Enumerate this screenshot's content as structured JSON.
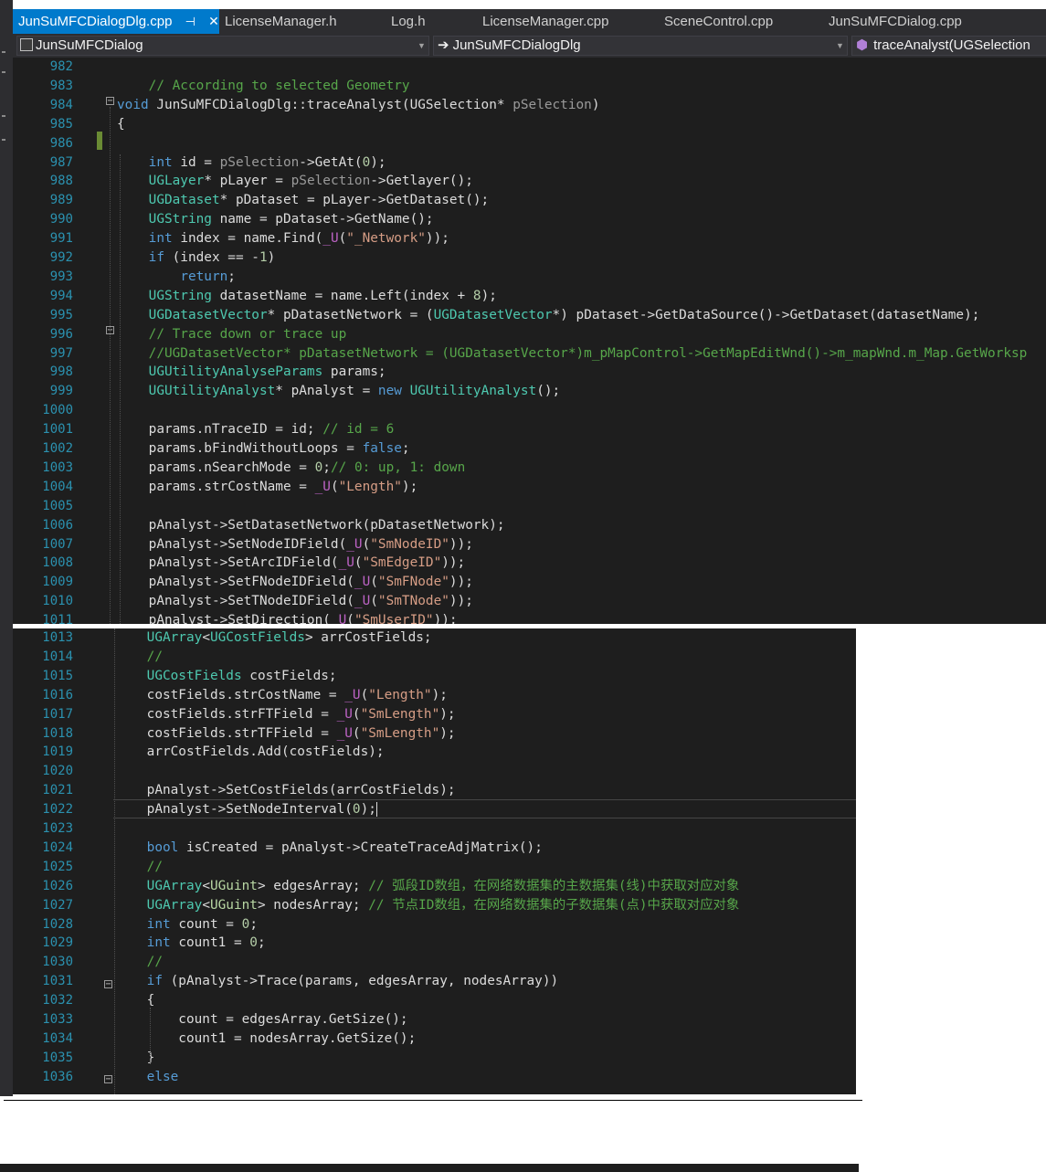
{
  "tabs": [
    {
      "label": "JunSuMFCDialogDlg.cpp",
      "active": true
    },
    {
      "label": "LicenseManager.h",
      "active": false
    },
    {
      "label": "Log.h",
      "active": false
    },
    {
      "label": "LicenseManager.cpp",
      "active": false
    },
    {
      "label": "SceneControl.cpp",
      "active": false
    },
    {
      "label": "JunSuMFCDialog.cpp",
      "active": false
    }
  ],
  "nav": {
    "project": "JunSuMFCDialog",
    "class": "JunSuMFCDialogDlg",
    "member": "traceAnalyst(UGSelection"
  },
  "pane1_lines": [
    {
      "n": "982",
      "code": ""
    },
    {
      "n": "983",
      "code": "    // According to selected Geometry"
    },
    {
      "n": "984",
      "code": "void JunSuMFCDialogDlg::traceAnalyst(UGSelection* pSelection)"
    },
    {
      "n": "985",
      "code": "{"
    },
    {
      "n": "986",
      "code": ""
    },
    {
      "n": "987",
      "code": "    int id = pSelection->GetAt(0);"
    },
    {
      "n": "988",
      "code": "    UGLayer* pLayer = pSelection->Getlayer();"
    },
    {
      "n": "989",
      "code": "    UGDataset* pDataset = pLayer->GetDataset();"
    },
    {
      "n": "990",
      "code": "    UGString name = pDataset->GetName();"
    },
    {
      "n": "991",
      "code": "    int index = name.Find(_U(\"_Network\"));"
    },
    {
      "n": "992",
      "code": "    if (index == -1)"
    },
    {
      "n": "993",
      "code": "        return;"
    },
    {
      "n": "994",
      "code": "    UGString datasetName = name.Left(index + 8);"
    },
    {
      "n": "995",
      "code": "    UGDatasetVector* pDatasetNetwork = (UGDatasetVector*) pDataset->GetDataSource()->GetDataset(datasetName);"
    },
    {
      "n": "996",
      "code": "    // Trace down or trace up"
    },
    {
      "n": "997",
      "code": "    //UGDatasetVector* pDatasetNetwork = (UGDatasetVector*)m_pMapControl->GetMapEditWnd()->m_mapWnd.m_Map.GetWorksp"
    },
    {
      "n": "998",
      "code": "    UGUtilityAnalyseParams params;"
    },
    {
      "n": "999",
      "code": "    UGUtilityAnalyst* pAnalyst = new UGUtilityAnalyst();"
    },
    {
      "n": "1000",
      "code": ""
    },
    {
      "n": "1001",
      "code": "    params.nTraceID = id; // id = 6"
    },
    {
      "n": "1002",
      "code": "    params.bFindWithoutLoops = false;"
    },
    {
      "n": "1003",
      "code": "    params.nSearchMode = 0;// 0: up, 1: down"
    },
    {
      "n": "1004",
      "code": "    params.strCostName = _U(\"Length\");"
    },
    {
      "n": "1005",
      "code": ""
    },
    {
      "n": "1006",
      "code": "    pAnalyst->SetDatasetNetwork(pDatasetNetwork);"
    },
    {
      "n": "1007",
      "code": "    pAnalyst->SetNodeIDField(_U(\"SmNodeID\"));"
    },
    {
      "n": "1008",
      "code": "    pAnalyst->SetArcIDField(_U(\"SmEdgeID\"));"
    },
    {
      "n": "1009",
      "code": "    pAnalyst->SetFNodeIDField(_U(\"SmFNode\"));"
    },
    {
      "n": "1010",
      "code": "    pAnalyst->SetTNodeIDField(_U(\"SmTNode\"));"
    },
    {
      "n": "1011",
      "code": "    pAnalyst->SetDirection(_U(\"SmUserID\"));"
    }
  ],
  "pane2_lines": [
    {
      "n": "1013",
      "code": "    UGArray<UGCostFields> arrCostFields;"
    },
    {
      "n": "1014",
      "code": "    //"
    },
    {
      "n": "1015",
      "code": "    UGCostFields costFields;"
    },
    {
      "n": "1016",
      "code": "    costFields.strCostName = _U(\"Length\");"
    },
    {
      "n": "1017",
      "code": "    costFields.strFTField = _U(\"SmLength\");"
    },
    {
      "n": "1018",
      "code": "    costFields.strTFField = _U(\"SmLength\");"
    },
    {
      "n": "1019",
      "code": "    arrCostFields.Add(costFields);"
    },
    {
      "n": "1020",
      "code": ""
    },
    {
      "n": "1021",
      "code": "    pAnalyst->SetCostFields(arrCostFields);"
    },
    {
      "n": "1022",
      "code": "    pAnalyst->SetNodeInterval(0);"
    },
    {
      "n": "1023",
      "code": ""
    },
    {
      "n": "1024",
      "code": "    bool isCreated = pAnalyst->CreateTraceAdjMatrix();"
    },
    {
      "n": "1025",
      "code": "    //"
    },
    {
      "n": "1026",
      "code": "    UGArray<UGuint> edgesArray; // 弧段ID数组，在网络数据集的主数据集(线)中获取对应对象"
    },
    {
      "n": "1027",
      "code": "    UGArray<UGuint> nodesArray; // 节点ID数组，在网络数据集的子数据集(点)中获取对应对象"
    },
    {
      "n": "1028",
      "code": "    int count = 0;"
    },
    {
      "n": "1029",
      "code": "    int count1 = 0;"
    },
    {
      "n": "1030",
      "code": "    //"
    },
    {
      "n": "1031",
      "code": "    if (pAnalyst->Trace(params, edgesArray, nodesArray))"
    },
    {
      "n": "1032",
      "code": "    {"
    },
    {
      "n": "1033",
      "code": "        count = edgesArray.GetSize();"
    },
    {
      "n": "1034",
      "code": "        count1 = nodesArray.GetSize();"
    },
    {
      "n": "1035",
      "code": "    }"
    },
    {
      "n": "1036",
      "code": "    else"
    }
  ],
  "colors": {
    "editor_bg": "#1e1e1e",
    "chrome_bg": "#2d2d30",
    "active_tab": "#007acc",
    "line_number": "#2b91af",
    "keyword": "#569cd6",
    "type": "#4ec9b0",
    "comment": "#57a64a",
    "string": "#d69d85",
    "number": "#b5cea8",
    "change_marker": "#6a8b34"
  },
  "icons": {
    "pin": "pin-icon",
    "close": "close-icon",
    "project": "project-icon",
    "class_arrow": "arrow-right-icon",
    "member": "method-cube-icon"
  }
}
